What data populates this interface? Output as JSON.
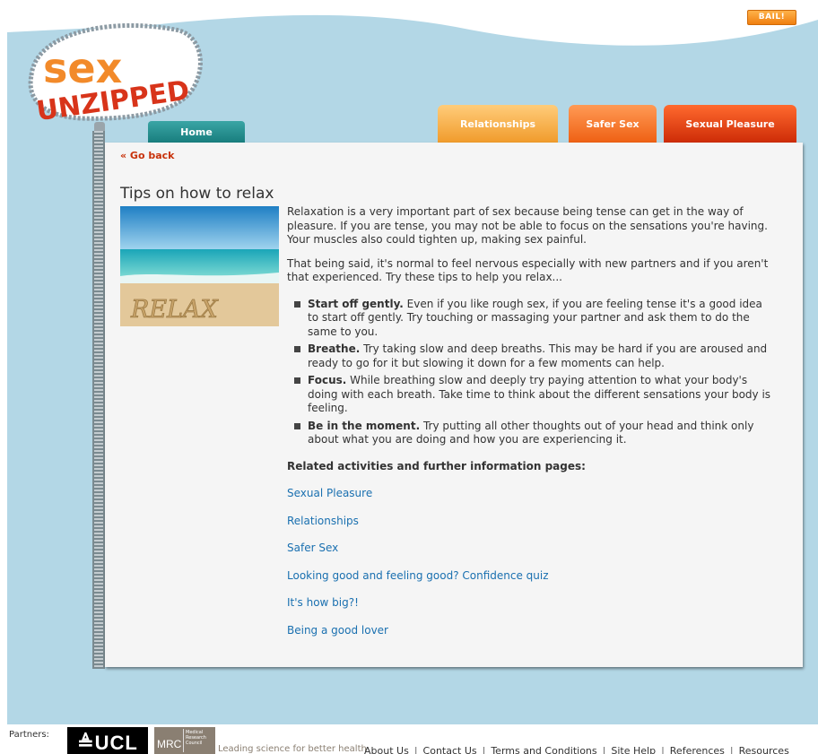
{
  "header": {
    "bail_label": "BAIL!",
    "logo_text": "SEX UNZIPPED"
  },
  "nav": {
    "home": "Home",
    "relationships": "Relationships",
    "safer_sex": "Safer Sex",
    "sexual_pleasure": "Sexual Pleasure"
  },
  "page": {
    "go_back": "« Go back",
    "title": "Tips on how to relax",
    "hero_text": "RELAX",
    "intro1": "Relaxation is a very important part of sex because being tense can get in the way of pleasure. If you are tense, you may not be able to focus on the sensations you're having. Your muscles also could tighten up, making sex painful.",
    "intro2": "That being said, it's normal to feel nervous especially with new partners and if you aren't that experienced. Try these tips to help you relax...",
    "tips": [
      {
        "bold": "Start off gently.",
        "text": " Even if you like rough sex, if you are feeling tense it's a good idea to start off gently. Try touching or massaging your partner and ask them to do the same to you."
      },
      {
        "bold": "Breathe.",
        "text": " Try taking slow and deep breaths. This may be hard if you are aroused and ready to go for it but slowing it down for a few moments can help."
      },
      {
        "bold": "Focus.",
        "text": " While breathing slow and deeply try paying attention to what your body's doing with each breath. Take time to think about the different sensations your body is feeling."
      },
      {
        "bold": "Be in the moment.",
        "text": " Try putting all other thoughts out of your head and think only about what you are doing and how you are experiencing it."
      }
    ],
    "related_heading": "Related activities and further information pages:",
    "related_links": [
      "Sexual Pleasure",
      "Relationships",
      "Safer Sex",
      "Looking good and feeling good? Confidence quiz",
      "It's how big?!",
      "Being a good lover"
    ]
  },
  "footer": {
    "partners_label": "Partners:",
    "ucl_logo": "≜UCL",
    "mrc_main": "MRC",
    "mrc_small": "Medical Research Council",
    "tagline": "Leading science for better health",
    "links": [
      "About Us",
      "Contact Us",
      "Terms and Conditions",
      "Site Help",
      "References",
      "Resources"
    ]
  },
  "colors": {
    "sky": "#b3d7e6",
    "accent_orange": "#f07f10",
    "home_teal": "#177c7c",
    "link_blue": "#1a70b0",
    "go_back_red": "#c8320a"
  }
}
